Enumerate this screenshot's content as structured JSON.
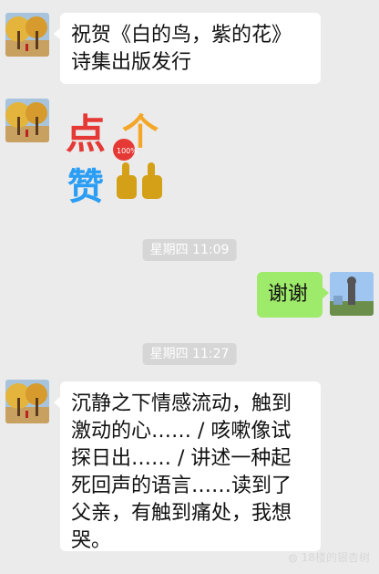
{
  "messages": [
    {
      "text": "祝贺《白的鸟，紫的花》诗集出版发行"
    },
    {
      "sticker": {
        "dian": "点",
        "ge": "个",
        "zan": "赞",
        "badge": "100%",
        "bg": "#e53935"
      }
    },
    {
      "time": "星期四 11:09"
    },
    {
      "reply": "谢谢"
    },
    {
      "time2": "星期四 11:27"
    },
    {
      "text": "沉静之下情感流动，触到激动的心…… / 咳嗽像试探日出…… / 讲述一种起死回声的语言……读到了父亲，有触到痛处，我想哭。"
    }
  ],
  "watermark": "18楼的银杏树",
  "colors": {
    "bubble_left": "#ffffff",
    "bubble_right": "#9eea6a",
    "background": "#ebebeb"
  }
}
